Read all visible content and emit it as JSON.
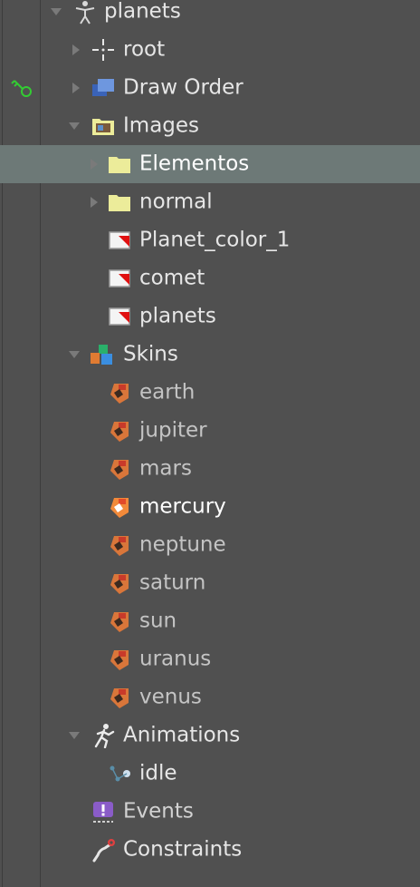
{
  "colors": {
    "panel_bg": "#505050",
    "selection_bg": "#6d7977",
    "text": "#e6e6e6",
    "text_dim": "#c4c4c4",
    "folder": "#ecec9a",
    "image_marker": "#e01010",
    "skin_orange": "#d9763a",
    "events_purple": "#8a5cc8",
    "constraint_red": "#e04040",
    "key_green": "#33cc33"
  },
  "tree": {
    "root_label": "planets",
    "root_icon": "skeleton-figure-icon",
    "nodes": {
      "root_bone": "root",
      "draw_order": "Draw Order",
      "images": "Images",
      "elementos": "Elementos",
      "normal": "normal",
      "planet_color_1": "Planet_color_1",
      "comet": "comet",
      "planets_image": "planets",
      "skins": "Skins",
      "animations": "Animations",
      "idle": "idle",
      "events": "Events",
      "constraints": "Constraints"
    },
    "skins": [
      {
        "label": "earth",
        "active": false
      },
      {
        "label": "jupiter",
        "active": false
      },
      {
        "label": "mars",
        "active": false
      },
      {
        "label": "mercury",
        "active": true
      },
      {
        "label": "neptune",
        "active": false
      },
      {
        "label": "saturn",
        "active": false
      },
      {
        "label": "sun",
        "active": false
      },
      {
        "label": "uranus",
        "active": false
      },
      {
        "label": "venus",
        "active": false
      }
    ],
    "selected": "Elementos"
  }
}
